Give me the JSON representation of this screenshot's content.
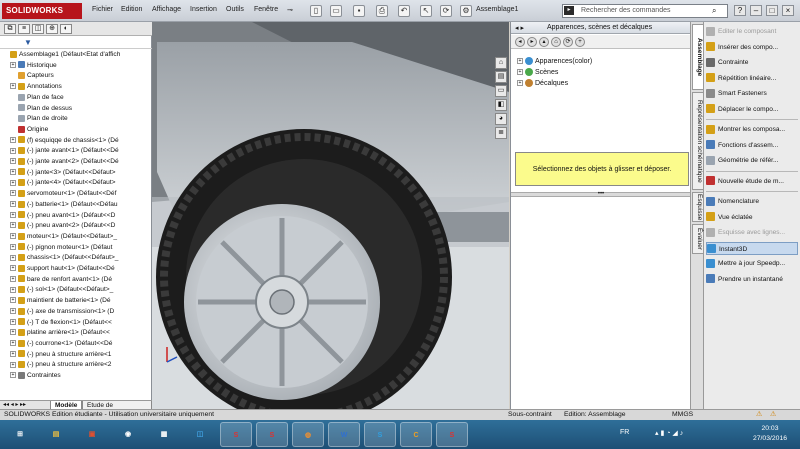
{
  "app": {
    "logo": "SOLIDWORKS",
    "document_title": "Assemblage1",
    "menu": [
      "Fichier",
      "Edition",
      "Affichage",
      "Insertion",
      "Outils",
      "Fenêtre"
    ],
    "search_placeholder": "Rechercher des commandes",
    "window_buttons": [
      "?",
      "–",
      "□",
      "×"
    ]
  },
  "feature_tree": {
    "items": [
      {
        "label": "Assemblage1  (Défaut<Etat d'affich",
        "icon": "assembly-icon",
        "color": "#d4a017",
        "expand": ""
      },
      {
        "label": "Historique",
        "icon": "history-icon",
        "color": "#4a7bb8",
        "expand": "+"
      },
      {
        "label": "Capteurs",
        "icon": "sensor-icon",
        "color": "#e0a030",
        "expand": ""
      },
      {
        "label": "Annotations",
        "icon": "annotation-icon",
        "color": "#d4a017",
        "expand": "+"
      },
      {
        "label": "Plan de face",
        "icon": "plane-icon",
        "color": "#9aa4b0",
        "expand": ""
      },
      {
        "label": "Plan de dessus",
        "icon": "plane-icon",
        "color": "#9aa4b0",
        "expand": ""
      },
      {
        "label": "Plan de droite",
        "icon": "plane-icon",
        "color": "#9aa4b0",
        "expand": ""
      },
      {
        "label": "Origine",
        "icon": "origin-icon",
        "color": "#c03030",
        "expand": ""
      },
      {
        "label": "(f) esquiqqe de chassis<1> (Dé",
        "icon": "part-icon",
        "color": "#d4a017",
        "expand": "+"
      },
      {
        "label": "(-) jante avant<1> (Défaut<<Dé",
        "icon": "part-icon",
        "color": "#d4a017",
        "expand": "+"
      },
      {
        "label": "(-) jante avant<2> (Défaut<<Dé",
        "icon": "part-icon",
        "color": "#d4a017",
        "expand": "+"
      },
      {
        "label": "(-) jante<3> (Défaut<<Défaut>",
        "icon": "part-icon",
        "color": "#d4a017",
        "expand": "+"
      },
      {
        "label": "(-) jante<4> (Défaut<<Défaut>",
        "icon": "part-icon",
        "color": "#d4a017",
        "expand": "+"
      },
      {
        "label": "servomoteur<1> (Défaut<<Déf",
        "icon": "part-icon",
        "color": "#d4a017",
        "expand": "+"
      },
      {
        "label": "(-) batterie<1> (Défaut<<Défau",
        "icon": "part-icon",
        "color": "#d4a017",
        "expand": "+"
      },
      {
        "label": "(-) pneu avant<1> (Défaut<<D",
        "icon": "part-icon",
        "color": "#d4a017",
        "expand": "+"
      },
      {
        "label": "(-) pneu avant<2> (Défaut<<D",
        "icon": "part-icon",
        "color": "#d4a017",
        "expand": "+"
      },
      {
        "label": "moteur<1> (Défaut<<Défaut>_",
        "icon": "part-icon",
        "color": "#d4a017",
        "expand": "+"
      },
      {
        "label": "(-) pignon moteur<1> (Défaut",
        "icon": "part-icon",
        "color": "#d4a017",
        "expand": "+"
      },
      {
        "label": "chassis<1> (Défaut<<Défaut>_",
        "icon": "part-icon",
        "color": "#d4a017",
        "expand": "+"
      },
      {
        "label": "support haut<1> (Défaut<<Dé",
        "icon": "part-icon",
        "color": "#d4a017",
        "expand": "+"
      },
      {
        "label": "bare de renfort avant<1> (Dé",
        "icon": "part-icon",
        "color": "#d4a017",
        "expand": "+"
      },
      {
        "label": "(-) sol<1> (Défaut<<Défaut>_",
        "icon": "part-icon",
        "color": "#d4a017",
        "expand": "+"
      },
      {
        "label": "maintient de batterie<1> (Dé",
        "icon": "part-icon",
        "color": "#d4a017",
        "expand": "+"
      },
      {
        "label": "(-) axe de transmission<1> (D",
        "icon": "part-icon",
        "color": "#d4a017",
        "expand": "+"
      },
      {
        "label": "(-) T de flexion<1> (Défaut<<",
        "icon": "part-icon",
        "color": "#d4a017",
        "expand": "+"
      },
      {
        "label": "platine arrière<1> (Défaut<<",
        "icon": "part-icon",
        "color": "#d4a017",
        "expand": "+"
      },
      {
        "label": "(-) courrone<1> (Défaut<<Dé",
        "icon": "part-icon",
        "color": "#d4a017",
        "expand": "+"
      },
      {
        "label": "(-) pneu à structure arrière<1",
        "icon": "part-icon",
        "color": "#d4a017",
        "expand": "+"
      },
      {
        "label": "(-) pneu à structure arrière<2",
        "icon": "part-icon",
        "color": "#d4a017",
        "expand": "+"
      },
      {
        "label": "Contraintes",
        "icon": "mates-icon",
        "color": "#7a7a7a",
        "expand": "+"
      }
    ],
    "bottom_tabs": [
      "Modèle",
      "Etude de mouvement"
    ]
  },
  "task_pane": {
    "title": "Apparences, scènes et décalques",
    "items": [
      {
        "label": "Apparences(color)",
        "color": "#3a8fd0"
      },
      {
        "label": "Scènes",
        "color": "#4aa84a"
      },
      {
        "label": "Décalques",
        "color": "#c08030"
      }
    ],
    "drop_hint": "Sélectionnez des objets à glisser et déposer.",
    "tabs": [
      "Assemblage",
      "Représentation schématique",
      "Esquisse",
      "Évaluer"
    ]
  },
  "command_panel": {
    "items": [
      {
        "label": "Editer le composant",
        "disabled": true,
        "active": false,
        "color": "#b0b0b0"
      },
      {
        "label": "Insérer des compo...",
        "disabled": false,
        "active": false,
        "color": "#d4a017"
      },
      {
        "label": "Contrainte",
        "disabled": false,
        "active": false,
        "color": "#6a6a6a"
      },
      {
        "label": "Répétition linéaire...",
        "disabled": false,
        "active": false,
        "color": "#d4a017"
      },
      {
        "label": "Smart Fasteners",
        "disabled": false,
        "active": false,
        "color": "#8a8a8a"
      },
      {
        "label": "Déplacer le compo...",
        "disabled": false,
        "active": false,
        "color": "#d4a017"
      },
      {
        "label": "Montrer les composa...",
        "disabled": false,
        "active": false,
        "color": "#d4a017"
      },
      {
        "label": "Fonctions d'assem...",
        "disabled": false,
        "active": false,
        "color": "#4a7bb8"
      },
      {
        "label": "Géométrie de référ...",
        "disabled": false,
        "active": false,
        "color": "#9aa4b0"
      },
      {
        "label": "Nouvelle étude de m...",
        "disabled": false,
        "active": false,
        "color": "#c03030"
      },
      {
        "label": "Nomenclature",
        "disabled": false,
        "active": false,
        "color": "#4a7bb8"
      },
      {
        "label": "Vue éclatée",
        "disabled": false,
        "active": false,
        "color": "#d4a017"
      },
      {
        "label": "Esquisse avec lignes...",
        "disabled": true,
        "active": false,
        "color": "#b0b0b0"
      },
      {
        "label": "Instant3D",
        "disabled": false,
        "active": true,
        "color": "#3a8fd0"
      },
      {
        "label": "Mettre à jour Speedp...",
        "disabled": false,
        "active": false,
        "color": "#3a8fd0"
      },
      {
        "label": "Prendre un instantané",
        "disabled": false,
        "active": false,
        "color": "#4a7bb8"
      }
    ]
  },
  "status_bar": {
    "left": "SOLIDWORKS Edition étudiante - Utilisation universitaire uniquement",
    "state": "Sous-contraint",
    "mode": "Edition: Assemblage",
    "units": "MMGS"
  },
  "taskbar": {
    "apps": [
      "Démarrer",
      "Explorateur",
      "Outil",
      "Chrome",
      "Applications",
      "Système",
      "SolidWorks",
      "SolidWorks 2015",
      "Blender",
      "Word",
      "Skype",
      "CCleaner",
      "SolidWorks 2015"
    ],
    "lang": "FR",
    "time": "20:03",
    "date": "27/03/2016"
  },
  "colors": {
    "accent": "#b7141b",
    "taskbar": "#2f6f99",
    "highlight": "#fbfb8c"
  }
}
